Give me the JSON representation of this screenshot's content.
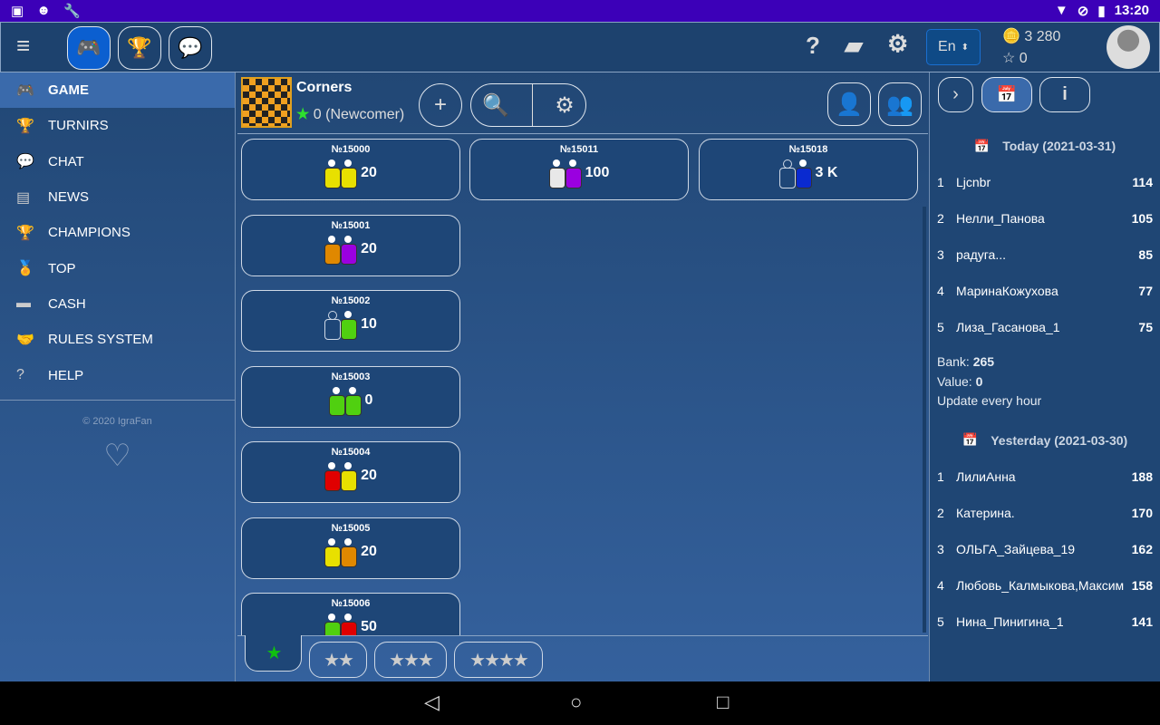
{
  "status": {
    "time": "13:20"
  },
  "header": {
    "lang": "En",
    "coins": "3 280",
    "stars": "0"
  },
  "sidebar": {
    "items": [
      {
        "label": "GAME",
        "icon": "gamepad-icon"
      },
      {
        "label": "TURNIRS",
        "icon": "trophy-icon"
      },
      {
        "label": "CHAT",
        "icon": "chat-icon"
      },
      {
        "label": "NEWS",
        "icon": "news-icon"
      },
      {
        "label": "CHAMPIONS",
        "icon": "cup-icon"
      },
      {
        "label": "TOP",
        "icon": "medal-icon"
      },
      {
        "label": "CASH",
        "icon": "wallet-icon"
      },
      {
        "label": "RULES SYSTEM",
        "icon": "handshake-icon"
      },
      {
        "label": "HELP",
        "icon": "question-icon"
      }
    ],
    "copyright": "© 2020 IgraFan"
  },
  "game": {
    "name": "Corners",
    "rating": "0 (Newcomer)"
  },
  "tables": [
    {
      "id": "№15000",
      "bet": "20",
      "players": [
        "#e8e000",
        "#e8e000"
      ]
    },
    {
      "id": "№15011",
      "bet": "100",
      "players": [
        "#e8e8e8",
        "#9a00e0"
      ]
    },
    {
      "id": "№15018",
      "bet": "3 K",
      "players": [
        "empty",
        "#0a2ad0"
      ]
    },
    {
      "id": "№15001",
      "bet": "20",
      "players": [
        "#e08800",
        "#9a00e0"
      ]
    },
    {
      "id": "№15002",
      "bet": "10",
      "players": [
        "empty",
        "#50d010"
      ]
    },
    {
      "id": "№15003",
      "bet": "0",
      "players": [
        "#50d010",
        "#50d010"
      ]
    },
    {
      "id": "№15004",
      "bet": "20",
      "players": [
        "#e00000",
        "#e8e000"
      ]
    },
    {
      "id": "№15005",
      "bet": "20",
      "players": [
        "#e8e000",
        "#e08800"
      ]
    },
    {
      "id": "№15006",
      "bet": "50",
      "players": [
        "#50d010",
        "#e00000"
      ]
    }
  ],
  "level_tabs": [
    "★",
    "★★",
    "★★★",
    "★★★★"
  ],
  "ranking": {
    "today_title": "Today (2021-03-31)",
    "today": [
      {
        "n": "1",
        "name": "Ljcnbr",
        "pts": "114"
      },
      {
        "n": "2",
        "name": "Нелли_Панова",
        "pts": "105"
      },
      {
        "n": "3",
        "name": "радуга...",
        "pts": "85"
      },
      {
        "n": "4",
        "name": "МаринаКожухова",
        "pts": "77"
      },
      {
        "n": "5",
        "name": "Лиза_Гасанова_1",
        "pts": "75"
      }
    ],
    "bank_label": "Bank:",
    "bank": "265",
    "value_label": "Value:",
    "value": "0",
    "update": "Update every hour",
    "yesterday_title": "Yesterday (2021-03-30)",
    "yesterday": [
      {
        "n": "1",
        "name": "ЛилиАнна",
        "pts": "188"
      },
      {
        "n": "2",
        "name": "Катерина.",
        "pts": "170"
      },
      {
        "n": "3",
        "name": "ОЛЬГА_Зайцева_19",
        "pts": "162"
      },
      {
        "n": "4",
        "name": "Любовь_Калмыкова,Максим",
        "pts": "158"
      },
      {
        "n": "5",
        "name": "Нина_Пинигина_1",
        "pts": "141"
      }
    ]
  }
}
